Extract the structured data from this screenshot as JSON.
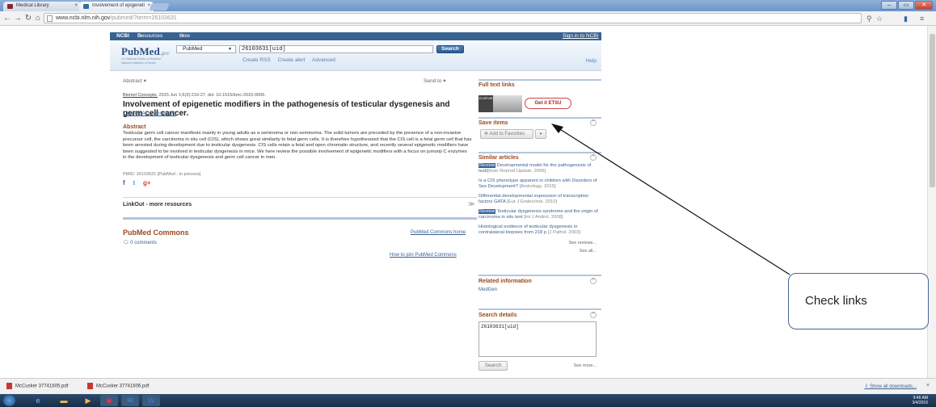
{
  "browser": {
    "tabs": [
      {
        "label": "Medical Library"
      },
      {
        "label": "Involvement of epigeneti"
      }
    ],
    "url_base": "www.ncbi.nlm.nih.gov",
    "url_rest": "/pubmed/?term=26103631",
    "window_controls": [
      "–",
      "▭",
      "✕"
    ]
  },
  "ncbi_bar": {
    "brand": "NCBI",
    "resources": "Resources",
    "howto": "How To",
    "signin": "Sign in to NCBI"
  },
  "header": {
    "logo_pub": "Pub",
    "logo_med": "Med",
    "logo_gov": ".gov",
    "logo_sub1": "US National Library of Medicine",
    "logo_sub2": "National Institutes of Health",
    "db_selected": "PubMed",
    "search_value": "26103631[uid]",
    "search_button": "Search",
    "links": [
      "Create RSS",
      "Create alert",
      "Advanced"
    ],
    "help": "Help"
  },
  "article": {
    "format": "Abstract ▾",
    "send_to": "Send to ▾",
    "journal": "Biomol Concepts.",
    "citation_rest": " 2015 Jun 1;6(3):219-27. doi: 10.1515/bmc-2015-0006.",
    "title": "Involvement of epigenetic modifiers in the pathogenesis of testicular dysgenesis and germ cell cancer.",
    "authors": "Lawaetz AC, Almstrup K.",
    "abstract_heading": "Abstract",
    "abstract_text": "Testicular germ cell cancer manifests mainly in young adults as a seminoma or non-seminoma. The solid tumors are preceded by the presence of a non-invasive precursor cell, the carcinoma in situ cell (CIS), which shows great similarity to fetal germ cells. It is therefore hypothesized that the CIS cell is a fetal germ cell that has been arrested during development due to testicular dysgenesis. CIS cells retain a fetal and open chromatin structure, and recently several epigenetic modifiers have been suggested to be involved in testicular dysgenesis in mice. We here review the possible involvement of epigenetic modifiers with a focus on jumonji C enzymes in the development of testicular dysgenesis and germ cell cancer in men.",
    "pmid": "PMID: 26103631 [PubMed - in process]",
    "share": [
      "f",
      "t",
      "g+"
    ]
  },
  "linkout": {
    "label": "LinkOut - more resources",
    "toggle": "≫"
  },
  "commons": {
    "heading": "PubMed Commons",
    "home_link": "PubMed Commons home",
    "comments": "0 comments",
    "join_link": "How to join PubMed Commons"
  },
  "sidebar": {
    "full_text": {
      "heading": "Full text links",
      "elsevier": "ELSEVIER",
      "getit": "Get it ETSU"
    },
    "save_items": {
      "heading": "Save items",
      "toggle": "⌃",
      "add_favorites": "Add to Favorites",
      "menu": "▾"
    },
    "similar": {
      "heading": "Similar articles",
      "toggle": "⌃",
      "items": [
        {
          "review": "Review",
          "text": " Developmental model for the pathogenesis of testi",
          "source": "[Hum Reprod Update. 2006]"
        },
        {
          "review": "",
          "text": "Is a CIS phenotype apparent in children with Disorders of Sex Development?",
          "source": "[Andrology. 2015]"
        },
        {
          "review": "",
          "text": "Differential developmental expression of transcription factors GATA",
          "source": "[Eur J Endocrinol. 2010]"
        },
        {
          "review": "Review",
          "text": " Testicular dysgenesis syndrome and the origin of carcinoma in situ test",
          "source": "[Int J Androl. 2008]"
        },
        {
          "review": "",
          "text": "Histological evidence of testicular dysgenesis in contralateral biopsies from 218 p",
          "source": "[J Pathol. 2003]"
        }
      ],
      "see_reviews": "See reviews...",
      "see_all": "See all..."
    },
    "related": {
      "heading": "Related information",
      "toggle": "⌃",
      "medgen": "MedGen"
    },
    "search_details": {
      "heading": "Search details",
      "toggle": "⌃",
      "query": "26103631[uid]",
      "search_button": "Search",
      "see_more": "See more..."
    }
  },
  "callout": {
    "text": "Check links"
  },
  "downloads": {
    "items": [
      "McCusker 37741605.pdf",
      "McCusker 37741606.pdf"
    ],
    "show_all": "Show all downloads...",
    "close": "×"
  },
  "taskbar": {
    "time": "9:46 AM",
    "date": "3/4/2016"
  },
  "colors": {
    "ncbi_blue": "#38628f",
    "heading_orange": "#9a4a1c",
    "link_blue": "#3a5f95"
  }
}
